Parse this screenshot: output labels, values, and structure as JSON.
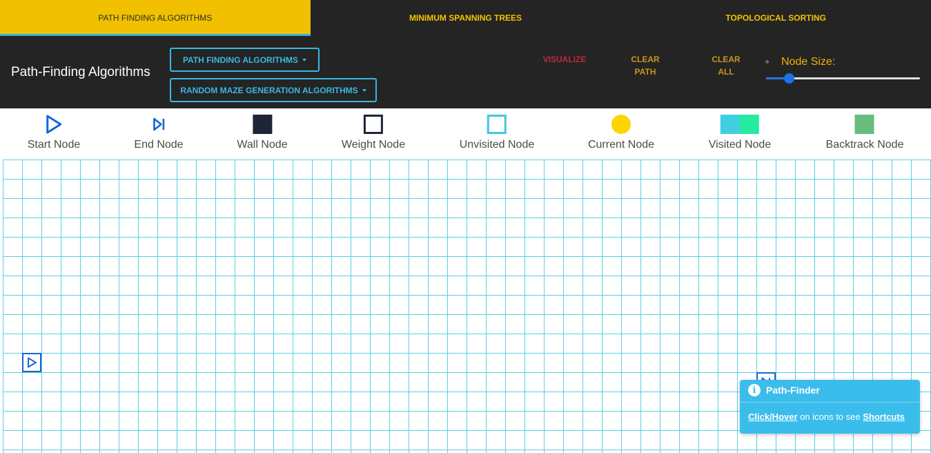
{
  "tabs": [
    {
      "label": "PATH FINDING ALGORITHMS",
      "active": true
    },
    {
      "label": "MINIMUM SPANNING TREES",
      "active": false
    },
    {
      "label": "TOPOLOGICAL SORTING",
      "active": false
    }
  ],
  "toolbar": {
    "title": "Path-Finding Algorithms",
    "algorithm_dropdown": "PATH FINDING ALGORITHMS",
    "maze_dropdown": "RANDOM MAZE GENERATION ALGORITHMS",
    "visualize": "VISUALIZE",
    "clear_path_line1": "CLEAR",
    "clear_path_line2": "PATH",
    "clear_all_line1": "CLEAR",
    "clear_all_line2": "ALL",
    "node_size_label": "Node Size:",
    "node_size_fraction": 0.15
  },
  "legend": [
    {
      "label": "Start Node",
      "icon": "start-play-icon"
    },
    {
      "label": "End Node",
      "icon": "end-skip-icon"
    },
    {
      "label": "Wall Node",
      "icon": "wall-square"
    },
    {
      "label": "Weight Node",
      "icon": "weight-square"
    },
    {
      "label": "Unvisited Node",
      "icon": "unvisited-square"
    },
    {
      "label": "Current Node",
      "icon": "current-circle"
    },
    {
      "label": "Visited Node",
      "icon": "visited-gradient"
    },
    {
      "label": "Backtrack Node",
      "icon": "backtrack-square"
    }
  ],
  "colors": {
    "accent_yellow": "#f1c101",
    "accent_blue": "#3ab8e0",
    "grid_line": "#5acfe0",
    "node_border": "#1565d8",
    "visualize": "#c0283c",
    "toast": "#3bbdec"
  },
  "toast": {
    "title": "Path-Finder",
    "link1": "Click/Hover",
    "middle": " on icons to see ",
    "link2": "Shortcuts"
  }
}
